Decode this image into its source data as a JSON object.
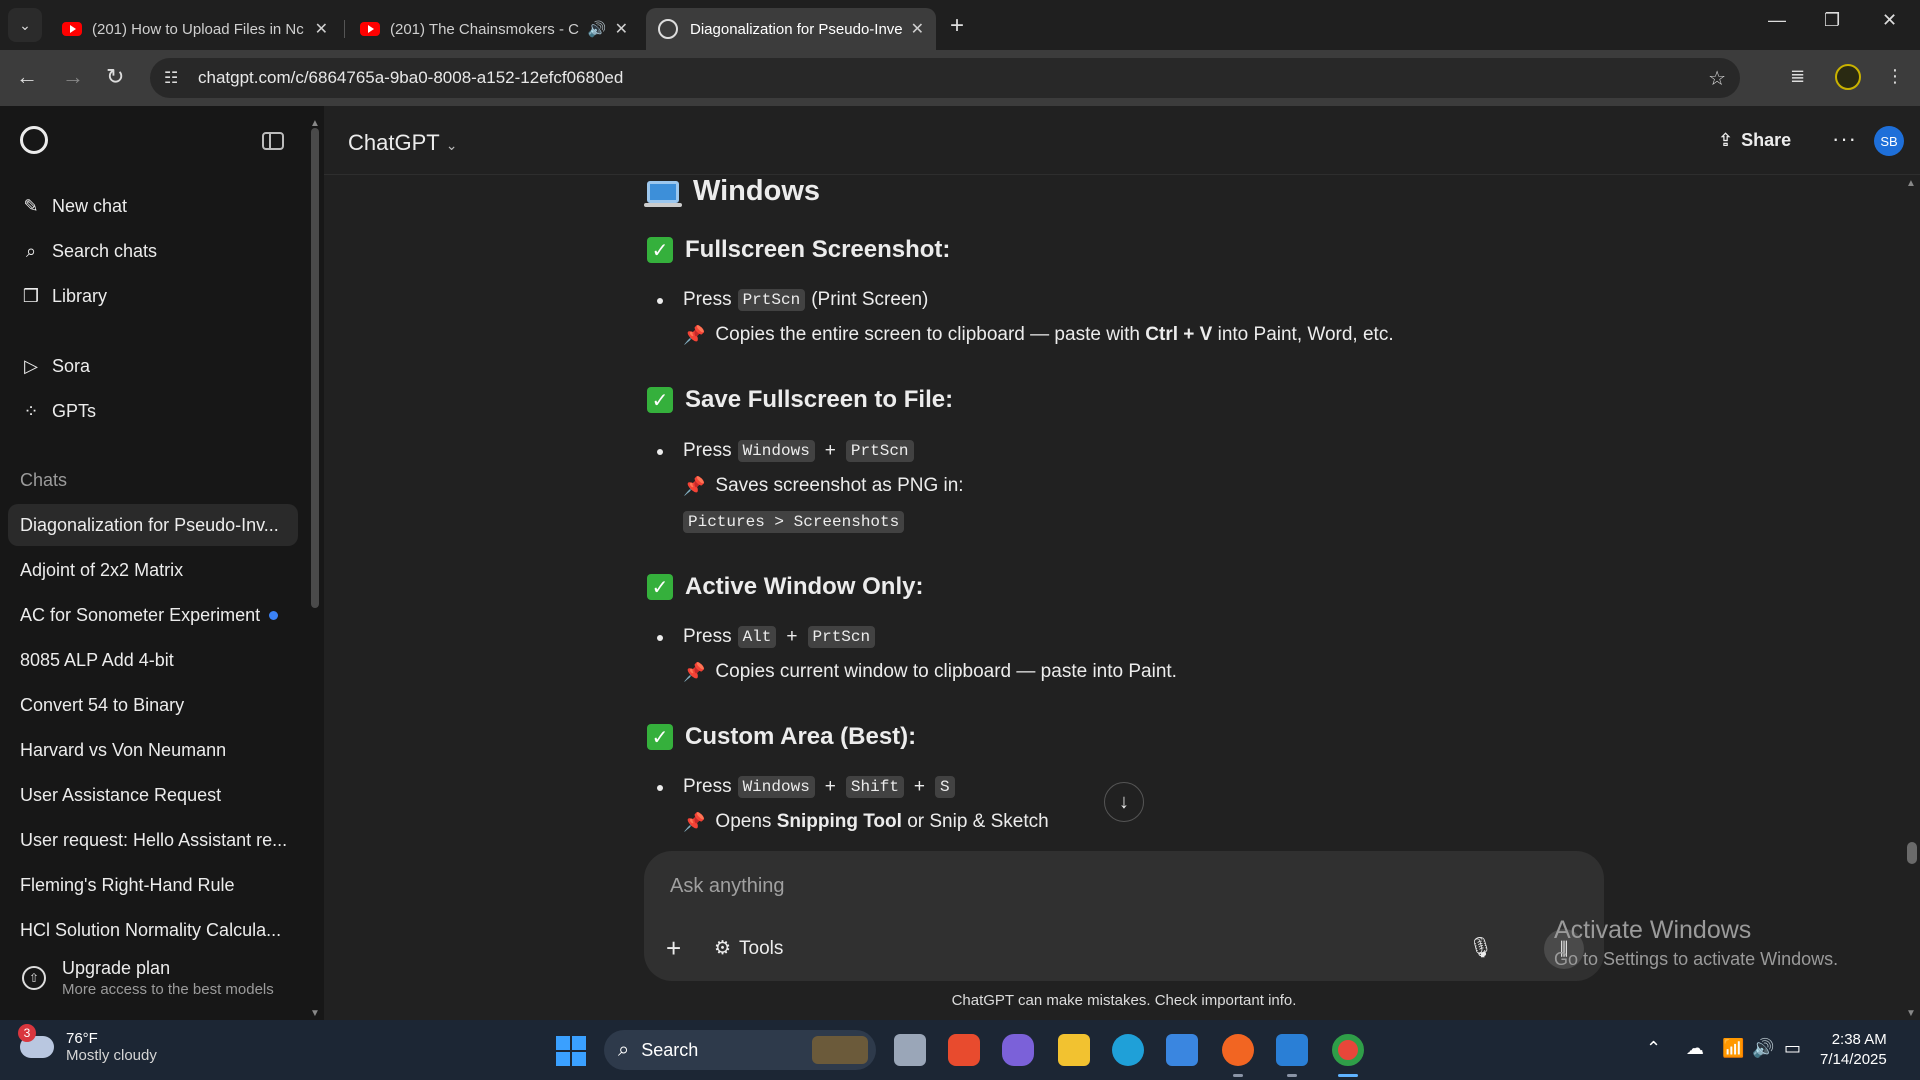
{
  "browser": {
    "tabs": [
      {
        "title": "(201) How to Upload Files in Nc",
        "type": "youtube"
      },
      {
        "title": "(201) The Chainsmokers - C",
        "type": "youtube",
        "audio": true
      },
      {
        "title": "Diagonalization for Pseudo-Inve",
        "type": "chatgpt",
        "active": true
      }
    ],
    "url": "chatgpt.com/c/6864765a-9ba0-8008-a152-12efcf0680ed"
  },
  "sidebar": {
    "nav": [
      {
        "label": "New chat",
        "icon": "edit-icon"
      },
      {
        "label": "Search chats",
        "icon": "search-icon"
      },
      {
        "label": "Library",
        "icon": "library-icon"
      },
      {
        "label": "Sora",
        "icon": "play-circle-icon"
      },
      {
        "label": "GPTs",
        "icon": "grid-icon"
      }
    ],
    "section_title": "Chats",
    "chats": [
      "Diagonalization for Pseudo-Inv...",
      "Adjoint of 2x2 Matrix",
      "AC for Sonometer Experiment",
      "8085 ALP Add 4-bit",
      "Convert 54 to Binary",
      "Harvard vs Von Neumann",
      "User Assistance Request",
      "User request: Hello Assistant re...",
      "Fleming's Right-Hand Rule",
      "HCl Solution Normality Calcula..."
    ],
    "upgrade": {
      "title": "Upgrade plan",
      "subtitle": "More access to the best models"
    }
  },
  "header": {
    "model": "ChatGPT",
    "share_label": "Share",
    "avatar_initials": "SB"
  },
  "content": {
    "heading": "Windows",
    "sections": {
      "fullscreen": {
        "title": "Fullscreen Screenshot:",
        "press": "Press",
        "key1": "PrtScn",
        "key1_note": "(Print Screen)",
        "note_a": "Copies the entire screen to clipboard — paste with",
        "note_bold": "Ctrl + V",
        "note_b": "into Paint, Word, etc."
      },
      "save": {
        "title": "Save Fullscreen to File:",
        "press": "Press",
        "key1": "Windows",
        "key2": "PrtScn",
        "note": "Saves screenshot as PNG in:",
        "path": "Pictures > Screenshots"
      },
      "active": {
        "title": "Active Window Only:",
        "press": "Press",
        "key1": "Alt",
        "key2": "PrtScn",
        "note": "Copies current window to clipboard — paste into Paint."
      },
      "custom": {
        "title": "Custom Area (Best):",
        "press": "Press",
        "key1": "Windows",
        "key2": "Shift",
        "key3": "S",
        "note_a": "Opens",
        "note_bold": "Snipping Tool",
        "note_b": "or Snip & Sketch"
      }
    }
  },
  "composer": {
    "placeholder": "Ask anything",
    "tools_label": "Tools",
    "disclaimer": "ChatGPT can make mistakes. Check important info."
  },
  "watermark": {
    "line1": "Activate Windows",
    "line2": "Go to Settings to activate Windows."
  },
  "taskbar": {
    "weather_temp": "76°F",
    "weather_desc": "Mostly cloudy",
    "weather_badge": "3",
    "search_label": "Search",
    "time": "2:38 AM",
    "date": "7/14/2025"
  }
}
